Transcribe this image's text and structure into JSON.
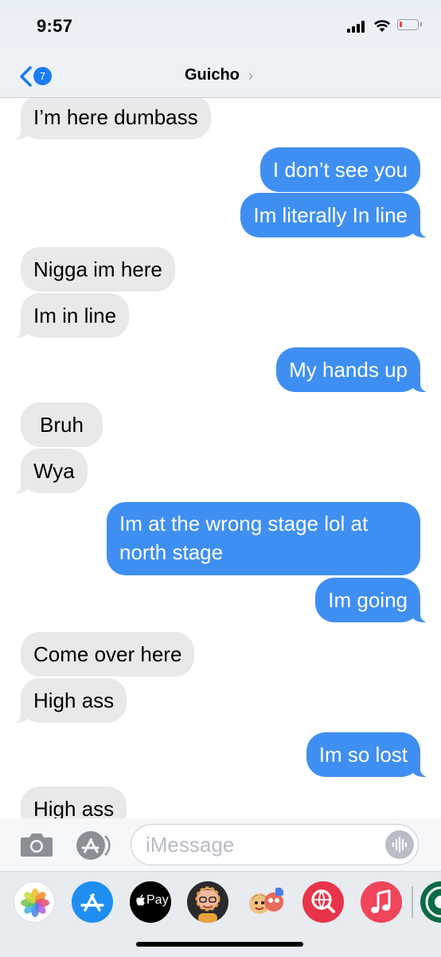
{
  "status_bar": {
    "time": "9:57"
  },
  "nav": {
    "back_count": "7",
    "contact_name": "Guicho"
  },
  "messages": [
    {
      "from": "them",
      "text": "I’m here dumbass"
    },
    {
      "from": "me",
      "text": "I don’t see you"
    },
    {
      "from": "me",
      "text": "Im literally In line"
    },
    {
      "from": "them",
      "text": "Nigga im here"
    },
    {
      "from": "them",
      "text": "Im in line"
    },
    {
      "from": "me",
      "text": "My hands up"
    },
    {
      "from": "them",
      "text": "Bruh"
    },
    {
      "from": "them",
      "text": "Wya"
    },
    {
      "from": "me",
      "text": "Im at the wrong stage lol at north stage"
    },
    {
      "from": "me",
      "text": "Im going"
    },
    {
      "from": "them",
      "text": "Come over here"
    },
    {
      "from": "them",
      "text": "High ass"
    },
    {
      "from": "me",
      "text": "Im so lost"
    },
    {
      "from": "them",
      "text": "High ass"
    }
  ],
  "compose": {
    "placeholder": "iMessage"
  },
  "app_drawer": {
    "apple_pay_label": "Pay",
    "apps": [
      "photos-icon",
      "app-store-icon",
      "apple-pay-icon",
      "memoji-icon",
      "memoji-stickers-icon",
      "web-search-icon",
      "music-icon",
      "starbucks-icon"
    ]
  },
  "colors": {
    "sent_bubble": "#3f8ff2",
    "received_bubble": "#e9e9eb",
    "accent": "#1a7cf5"
  }
}
